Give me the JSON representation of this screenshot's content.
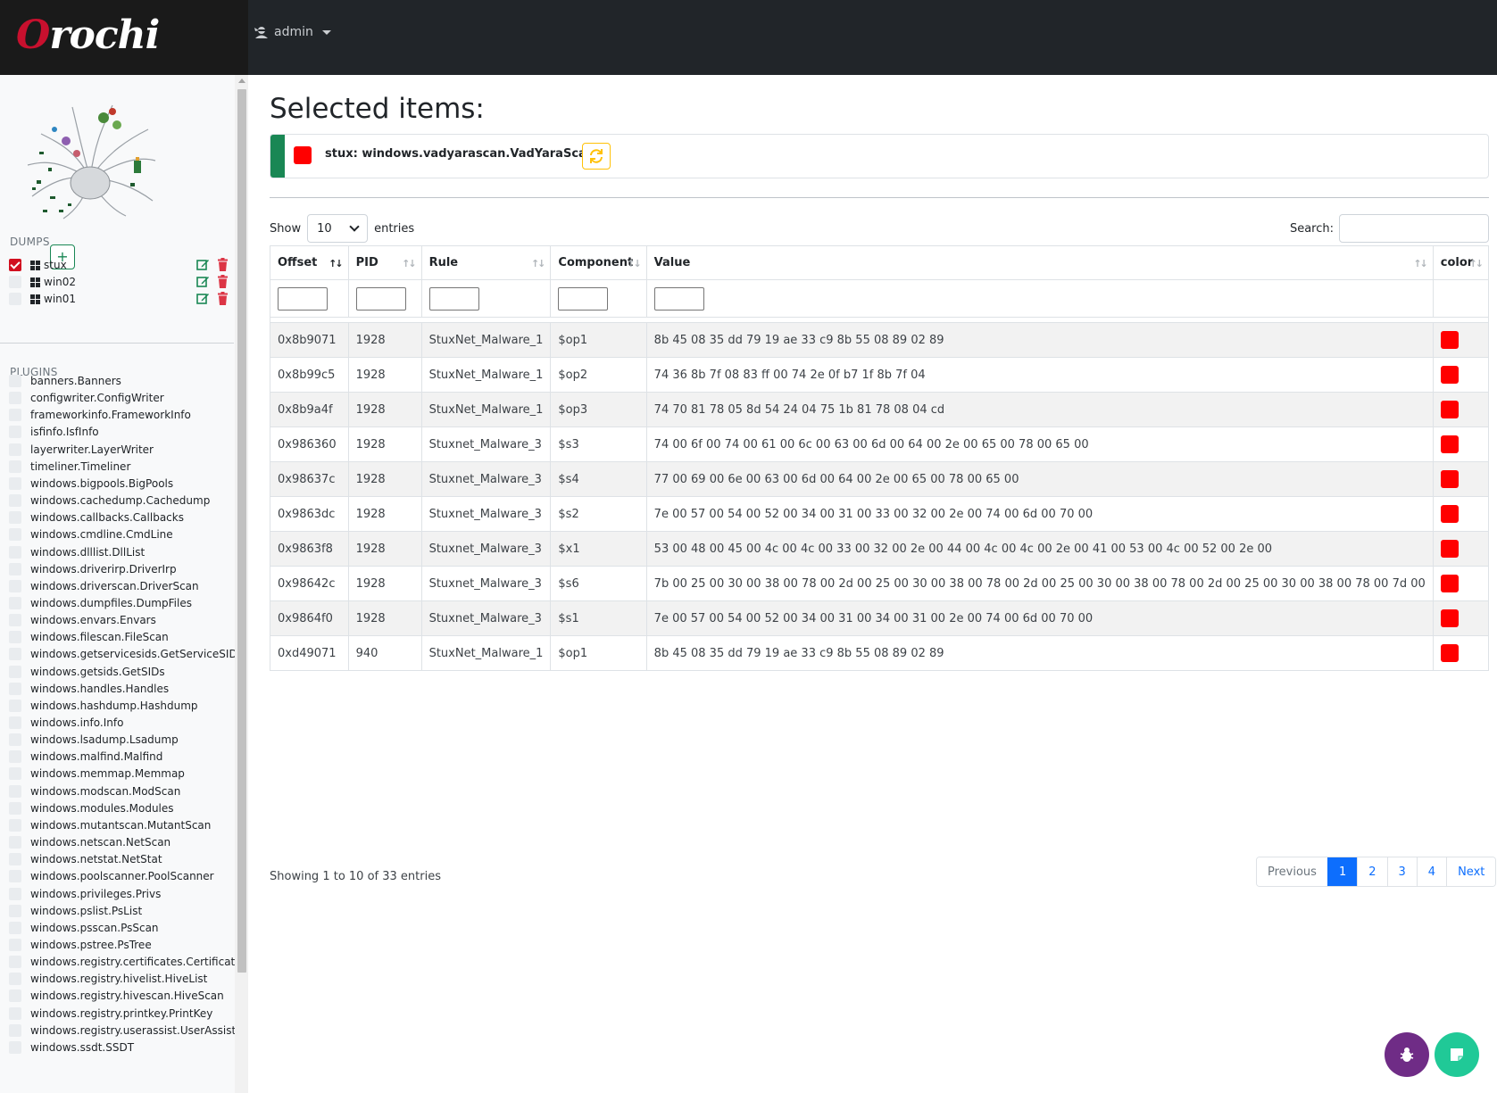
{
  "brand": {
    "first": "O",
    "rest": "rochi"
  },
  "navbar": {
    "user": "admin"
  },
  "sidebar": {
    "dumps_label": "DUMPS",
    "add_label": "+",
    "dumps": [
      {
        "name": "stux",
        "checked": true
      },
      {
        "name": "win02",
        "checked": false
      },
      {
        "name": "win01",
        "checked": false
      }
    ],
    "plugins_label": "PLUGINS",
    "plugins": [
      "banners.Banners",
      "configwriter.ConfigWriter",
      "frameworkinfo.FrameworkInfo",
      "isfinfo.IsfInfo",
      "layerwriter.LayerWriter",
      "timeliner.Timeliner",
      "windows.bigpools.BigPools",
      "windows.cachedump.Cachedump",
      "windows.callbacks.Callbacks",
      "windows.cmdline.CmdLine",
      "windows.dlllist.DllList",
      "windows.driverirp.DriverIrp",
      "windows.driverscan.DriverScan",
      "windows.dumpfiles.DumpFiles",
      "windows.envars.Envars",
      "windows.filescan.FileScan",
      "windows.getservicesids.GetServiceSIDs",
      "windows.getsids.GetSIDs",
      "windows.handles.Handles",
      "windows.hashdump.Hashdump",
      "windows.info.Info",
      "windows.lsadump.Lsadump",
      "windows.malfind.Malfind",
      "windows.memmap.Memmap",
      "windows.modscan.ModScan",
      "windows.modules.Modules",
      "windows.mutantscan.MutantScan",
      "windows.netscan.NetScan",
      "windows.netstat.NetStat",
      "windows.poolscanner.PoolScanner",
      "windows.privileges.Privs",
      "windows.pslist.PsList",
      "windows.psscan.PsScan",
      "windows.pstree.PsTree",
      "windows.registry.certificates.Certificates",
      "windows.registry.hivelist.HiveList",
      "windows.registry.hivescan.HiveScan",
      "windows.registry.printkey.PrintKey",
      "windows.registry.userassist.UserAssist",
      "windows.ssdt.SSDT"
    ]
  },
  "main": {
    "title": "Selected items:",
    "selected_item": {
      "label": "stux: windows.vadyarascan.VadYaraScan",
      "color": "#ff0000"
    },
    "length": {
      "show": "Show",
      "value": "10",
      "entries": "entries"
    },
    "search_label": "Search:",
    "columns": [
      "Offset",
      "PID",
      "Rule",
      "Component",
      "Value",
      "color"
    ],
    "rows": [
      [
        "0x8b9071",
        "1928",
        "StuxNet_Malware_1",
        "$op1",
        "8b 45 08 35 dd 79 19 ae 33 c9 8b 55 08 89 02 89"
      ],
      [
        "0x8b99c5",
        "1928",
        "StuxNet_Malware_1",
        "$op2",
        "74 36 8b 7f 08 83 ff 00 74 2e 0f b7 1f 8b 7f 04"
      ],
      [
        "0x8b9a4f",
        "1928",
        "StuxNet_Malware_1",
        "$op3",
        "74 70 81 78 05 8d 54 24 04 75 1b 81 78 08 04 cd"
      ],
      [
        "0x986360",
        "1928",
        "Stuxnet_Malware_3",
        "$s3",
        "74 00 6f 00 74 00 61 00 6c 00 63 00 6d 00 64 00 2e 00 65 00 78 00 65 00"
      ],
      [
        "0x98637c",
        "1928",
        "Stuxnet_Malware_3",
        "$s4",
        "77 00 69 00 6e 00 63 00 6d 00 64 00 2e 00 65 00 78 00 65 00"
      ],
      [
        "0x9863dc",
        "1928",
        "Stuxnet_Malware_3",
        "$s2",
        "7e 00 57 00 54 00 52 00 34 00 31 00 33 00 32 00 2e 00 74 00 6d 00 70 00"
      ],
      [
        "0x9863f8",
        "1928",
        "Stuxnet_Malware_3",
        "$x1",
        "53 00 48 00 45 00 4c 00 4c 00 33 00 32 00 2e 00 44 00 4c 00 4c 00 2e 00 41 00 53 00 4c 00 52 00 2e 00"
      ],
      [
        "0x98642c",
        "1928",
        "Stuxnet_Malware_3",
        "$s6",
        "7b 00 25 00 30 00 38 00 78 00 2d 00 25 00 30 00 38 00 78 00 2d 00 25 00 30 00 38 00 78 00 2d 00 25 00 30 00 38 00 78 00 7d 00"
      ],
      [
        "0x9864f0",
        "1928",
        "Stuxnet_Malware_3",
        "$s1",
        "7e 00 57 00 54 00 52 00 34 00 31 00 34 00 31 00 2e 00 74 00 6d 00 70 00"
      ],
      [
        "0xd49071",
        "940",
        "StuxNet_Malware_1",
        "$op1",
        "8b 45 08 35 dd 79 19 ae 33 c9 8b 55 08 89 02 89"
      ]
    ],
    "row_color": "#ff0000",
    "info": "Showing 1 to 10 of 33 entries",
    "pagination": [
      "Previous",
      "1",
      "2",
      "3",
      "4",
      "Next"
    ],
    "active_page": "1"
  },
  "colors": {
    "navbar": "#212529",
    "accent_green": "#198754",
    "accent_blue": "#0d6efd",
    "warning": "#ffc107",
    "danger": "#dc3545"
  },
  "icons": {
    "user": "user-ninja-icon",
    "add_dump": "plus-icon",
    "edit": "edit-icon",
    "delete": "trash-icon",
    "os": "windows-icon",
    "refresh": "refresh-icon",
    "fab_left": "bug-icon",
    "fab_right": "note-icon"
  }
}
